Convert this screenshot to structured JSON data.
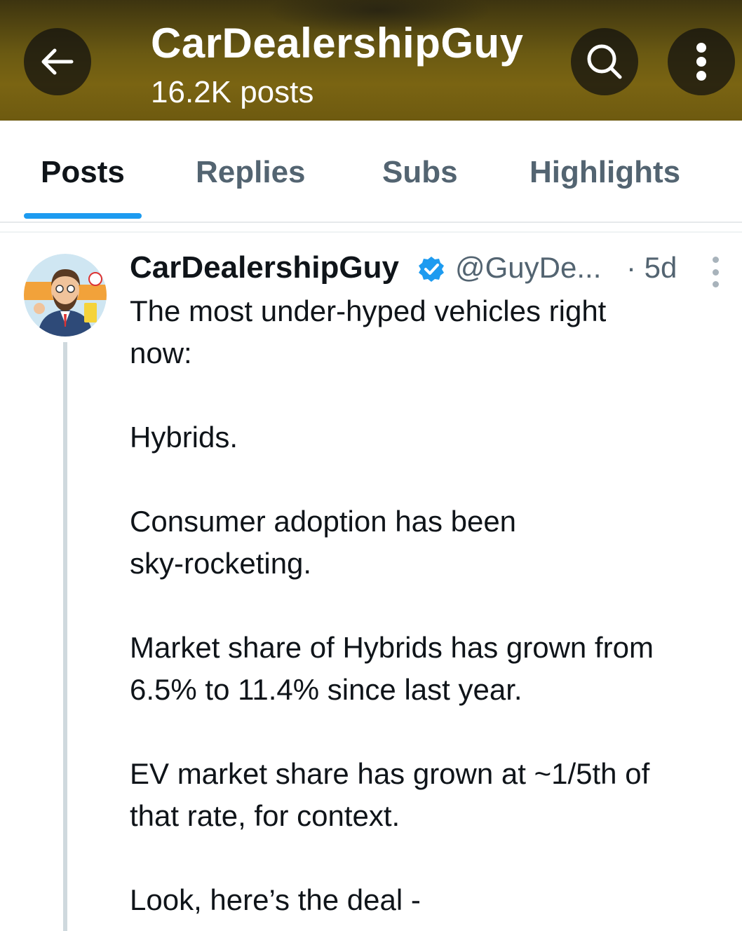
{
  "header": {
    "title": "CarDealershipGuy",
    "posts_count": "16.2K posts",
    "back_icon": "arrow-left-icon",
    "search_icon": "search-icon",
    "more_icon": "more-vertical-icon",
    "banner_color": "#6b5a12"
  },
  "tabs": [
    {
      "label": "Posts",
      "active": true
    },
    {
      "label": "Replies",
      "active": false
    },
    {
      "label": "Subs",
      "active": false
    },
    {
      "label": "Highlights",
      "active": false
    }
  ],
  "accent_color": "#1d9bf0",
  "post": {
    "author": "CarDealershipGuy",
    "verified": true,
    "handle": "@GuyDe...",
    "time": "· 5d",
    "lines": [
      "The most under-hyped vehicles right",
      "now:",
      "Hybrids.",
      "Consumer adoption has been",
      "sky-rocketing.",
      "Market share of Hybrids has grown from",
      "6.5% to 11.4% since last year.",
      "EV market share has grown at ~1/5th of",
      "that rate, for context.",
      "Look, here’s the deal -"
    ]
  }
}
